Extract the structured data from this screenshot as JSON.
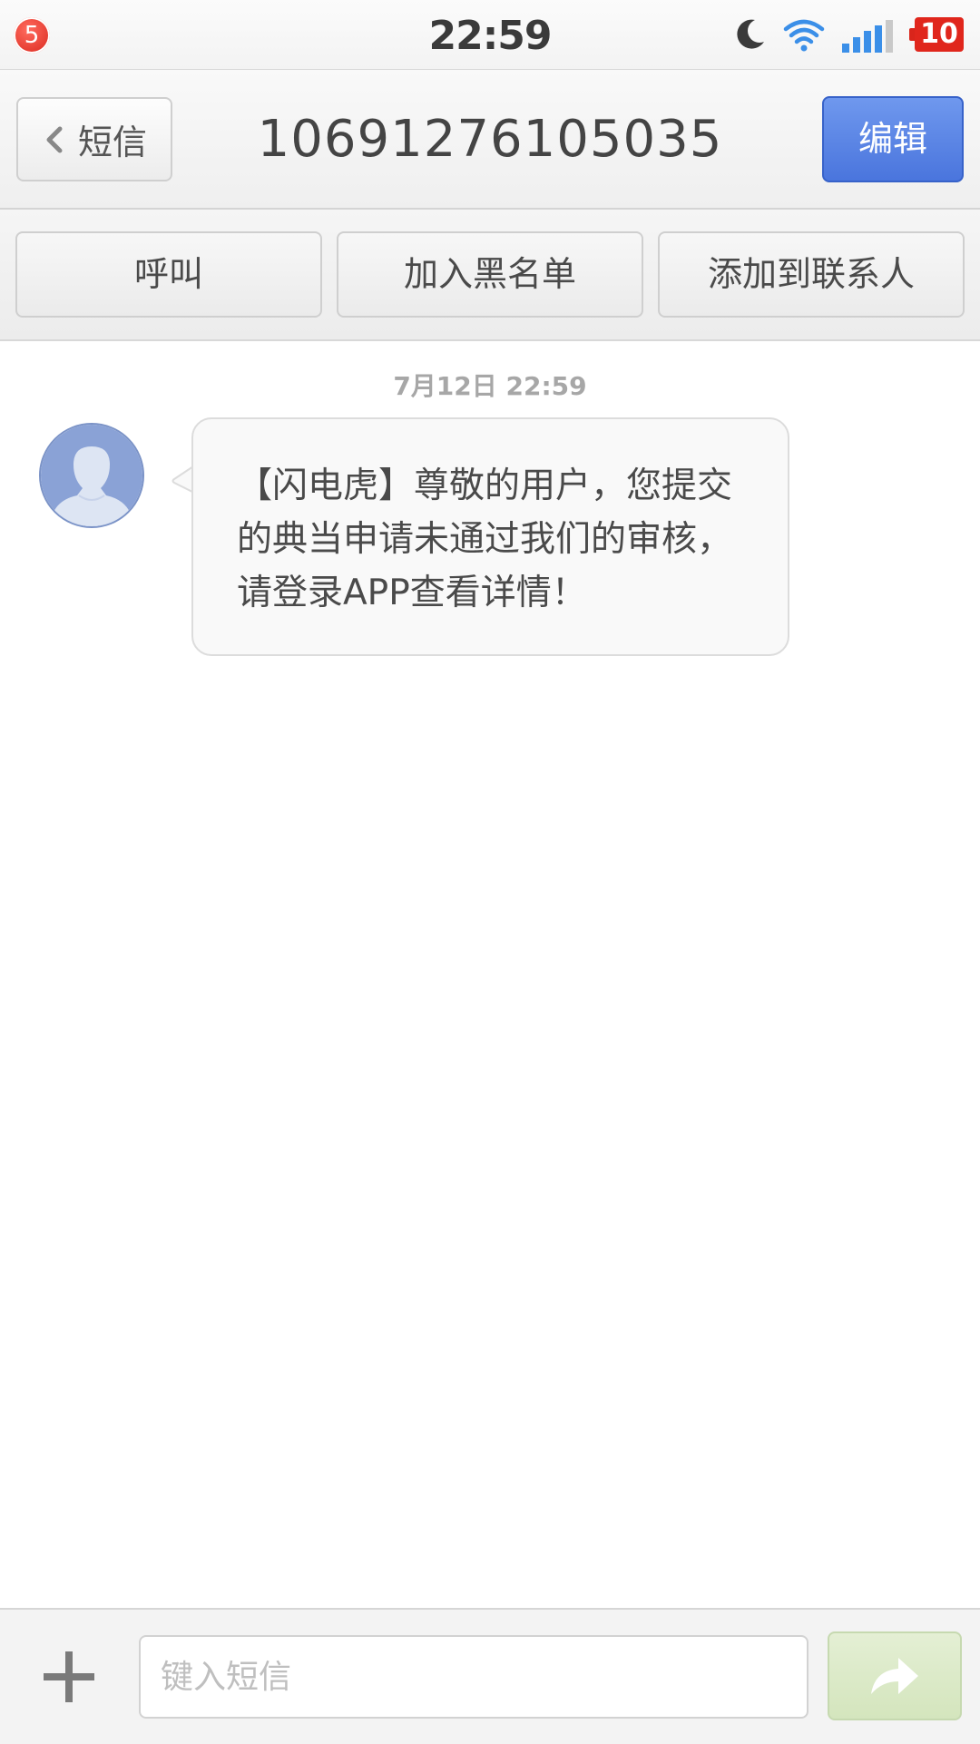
{
  "status_bar": {
    "notification_count": "5",
    "time": "22:59",
    "battery": "10",
    "icons": [
      "moon-icon",
      "wifi-icon",
      "signal-icon",
      "battery-icon"
    ]
  },
  "nav": {
    "back_label": "短信",
    "title": "10691276105035",
    "edit_label": "编辑"
  },
  "actions": {
    "call": "呼叫",
    "block": "加入黑名单",
    "add_contact": "添加到联系人"
  },
  "conversation": {
    "messages": [
      {
        "timestamp": "7月12日 22:59",
        "text": "【闪电虎】尊敬的用户，您提交的典当申请未通过我们的审核，请登录APP查看详情！"
      }
    ]
  },
  "compose": {
    "placeholder": "键入短信",
    "value": ""
  },
  "colors": {
    "accent_blue": "#4a75dd",
    "badge_red": "#e0261c",
    "send_green": "#d4e5bd",
    "avatar_blue": "#8aa2d6"
  }
}
